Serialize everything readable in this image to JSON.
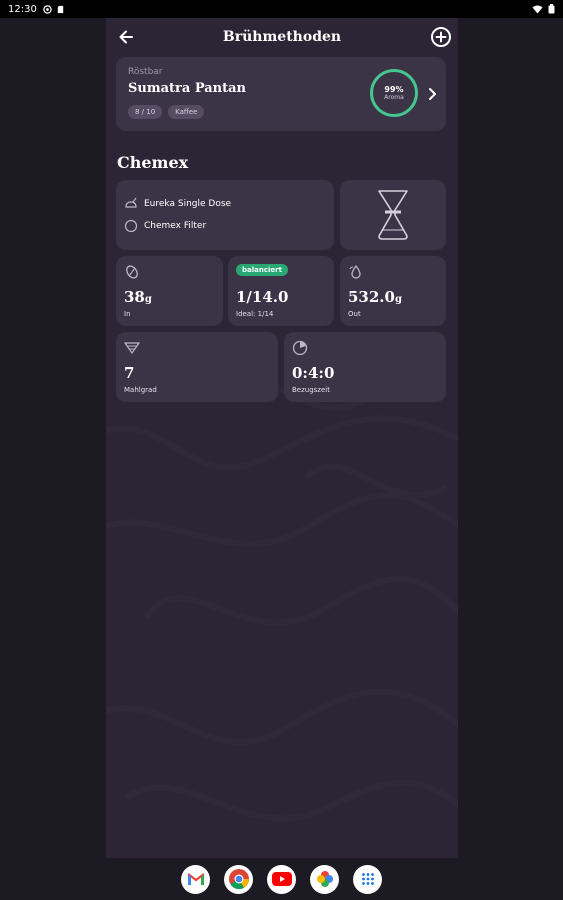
{
  "status_bar": {
    "time": "12:30"
  },
  "header": {
    "title": "Brühmethoden"
  },
  "bean": {
    "roastery": "Röstbar",
    "name": "Sumatra Pantan",
    "tags": [
      "8 / 10",
      "Kaffee"
    ],
    "aroma_percent": "99%",
    "aroma_label": "Aroma",
    "aroma_level": 0.99
  },
  "method": {
    "title": "Chemex",
    "grinder": "Eureka Single Dose",
    "filter": "Chemex Filter"
  },
  "stats": {
    "in": {
      "value": "38",
      "unit": "g",
      "label": "In"
    },
    "ratio": {
      "badge": "balanciert",
      "value": "1/14.0",
      "label": "Ideal: 1/14"
    },
    "out": {
      "value": "532.0",
      "unit": "g",
      "label": "Out"
    },
    "grind": {
      "value": "7",
      "label": "Mahlgrad"
    },
    "time": {
      "value": "0:4:0",
      "label": "Bezugszeit"
    }
  },
  "dock": {
    "apps": [
      "gmail-icon",
      "chrome-icon",
      "youtube-icon",
      "photos-icon",
      "app-drawer-icon"
    ]
  },
  "colors": {
    "background": "#1c1a22",
    "surface": "#2b2535",
    "card": "#3b3447",
    "accent_green": "#47c58f",
    "badge_green": "#2aa873"
  }
}
